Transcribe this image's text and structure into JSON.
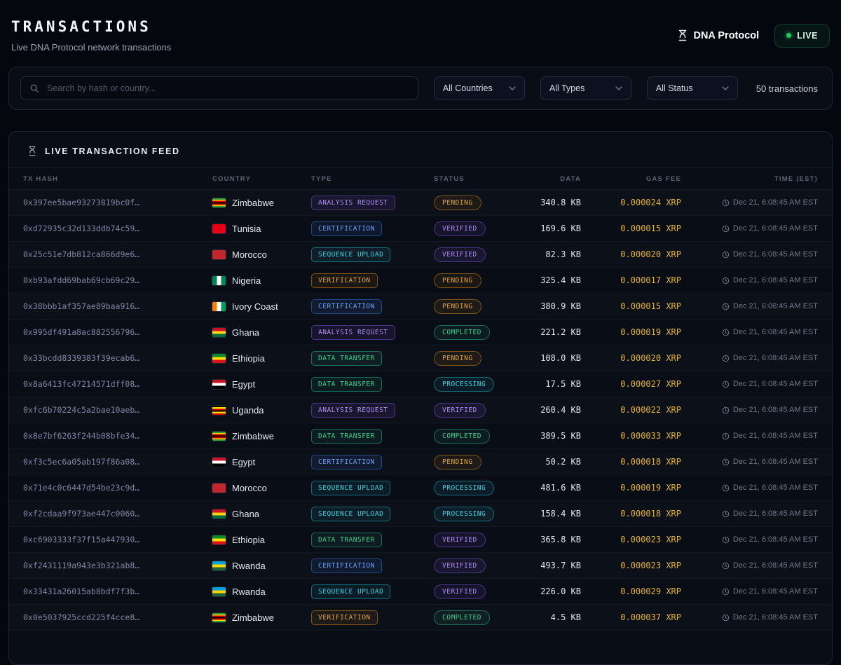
{
  "header": {
    "title": "TRANSACTIONS",
    "subtitle": "Live DNA Protocol network transactions",
    "brand": "DNA Protocol",
    "live_label": "LIVE"
  },
  "filters": {
    "search_placeholder": "Search by hash or country...",
    "country_filter": "All Countries",
    "type_filter": "All Types",
    "status_filter": "All Status",
    "count_label": "50 transactions"
  },
  "colors": {
    "background": "#05070e",
    "panel": "#090d16",
    "live_green": "#22c55e",
    "gas_gold": "#e4b23c",
    "purple": "#b18cf5",
    "blue": "#6ea2f8",
    "cyan": "#3fd2e2",
    "amber": "#dfa73b",
    "green": "#3ecf8e"
  },
  "flags": {
    "zimbabwe": {
      "dir": "h",
      "colors": [
        "#319e3f",
        "#ffd200",
        "#d40000",
        "#000000",
        "#d40000",
        "#ffd200",
        "#319e3f"
      ]
    },
    "tunisia": {
      "dir": "h",
      "colors": [
        "#e70013"
      ]
    },
    "morocco": {
      "dir": "h",
      "colors": [
        "#c1272d"
      ]
    },
    "nigeria": {
      "dir": "v",
      "colors": [
        "#008751",
        "#ffffff",
        "#008751"
      ]
    },
    "ivory-coast": {
      "dir": "v",
      "colors": [
        "#f77f00",
        "#ffffff",
        "#009e60"
      ]
    },
    "ghana": {
      "dir": "h",
      "colors": [
        "#ce1126",
        "#fcd116",
        "#006b3f"
      ]
    },
    "ethiopia": {
      "dir": "h",
      "colors": [
        "#078930",
        "#fcdd09",
        "#da121a"
      ]
    },
    "egypt": {
      "dir": "h",
      "colors": [
        "#ce1126",
        "#ffffff",
        "#000000"
      ]
    },
    "uganda": {
      "dir": "h",
      "colors": [
        "#000000",
        "#fcdc04",
        "#d90000",
        "#000000",
        "#fcdc04",
        "#d90000"
      ]
    },
    "rwanda": {
      "dir": "h",
      "colors": [
        "#00a1de",
        "#fad201",
        "#20603d"
      ]
    }
  },
  "feed": {
    "title": "LIVE TRANSACTION FEED",
    "columns": [
      "TX HASH",
      "COUNTRY",
      "TYPE",
      "STATUS",
      "DATA",
      "GAS FEE",
      "TIME (EST)"
    ],
    "rows": [
      {
        "hash": "0x397ee5bae93273819bc0f…",
        "country": "Zimbabwe",
        "flag": "zimbabwe",
        "type": "ANALYSIS REQUEST",
        "type_color": "purple",
        "status": "PENDING",
        "status_color": "amber",
        "data": "340.8 KB",
        "gas": "0.000024 XRP",
        "time": "Dec 21, 6:08:45 AM EST"
      },
      {
        "hash": "0xd72935c32d133ddb74c59…",
        "country": "Tunisia",
        "flag": "tunisia",
        "type": "CERTIFICATION",
        "type_color": "blue",
        "status": "VERIFIED",
        "status_color": "purple",
        "data": "169.6 KB",
        "gas": "0.000015 XRP",
        "time": "Dec 21, 6:08:45 AM EST"
      },
      {
        "hash": "0x25c51e7db812ca866d9e6…",
        "country": "Morocco",
        "flag": "morocco",
        "type": "SEQUENCE UPLOAD",
        "type_color": "cyan",
        "status": "VERIFIED",
        "status_color": "purple",
        "data": "82.3 KB",
        "gas": "0.000020 XRP",
        "time": "Dec 21, 6:08:45 AM EST"
      },
      {
        "hash": "0xb93afdd69bab69cb69c29…",
        "country": "Nigeria",
        "flag": "nigeria",
        "type": "VERIFICATION",
        "type_color": "amber",
        "status": "PENDING",
        "status_color": "amber",
        "data": "325.4 KB",
        "gas": "0.000017 XRP",
        "time": "Dec 21, 6:08:45 AM EST"
      },
      {
        "hash": "0x38bbb1af357ae89baa916…",
        "country": "Ivory Coast",
        "flag": "ivory-coast",
        "type": "CERTIFICATION",
        "type_color": "blue",
        "status": "PENDING",
        "status_color": "amber",
        "data": "380.9 KB",
        "gas": "0.000015 XRP",
        "time": "Dec 21, 6:08:45 AM EST"
      },
      {
        "hash": "0x995df491a8ac882556796…",
        "country": "Ghana",
        "flag": "ghana",
        "type": "ANALYSIS REQUEST",
        "type_color": "purple",
        "status": "COMPLETED",
        "status_color": "green",
        "data": "221.2 KB",
        "gas": "0.000019 XRP",
        "time": "Dec 21, 6:08:45 AM EST"
      },
      {
        "hash": "0x33bcdd8339383f39ecab6…",
        "country": "Ethiopia",
        "flag": "ethiopia",
        "type": "DATA TRANSFER",
        "type_color": "green",
        "status": "PENDING",
        "status_color": "amber",
        "data": "108.0 KB",
        "gas": "0.000020 XRP",
        "time": "Dec 21, 6:08:45 AM EST"
      },
      {
        "hash": "0x8a6413fc47214571dff08…",
        "country": "Egypt",
        "flag": "egypt",
        "type": "DATA TRANSFER",
        "type_color": "green",
        "status": "PROCESSING",
        "status_color": "cyan",
        "data": "17.5 KB",
        "gas": "0.000027 XRP",
        "time": "Dec 21, 6:08:45 AM EST"
      },
      {
        "hash": "0xfc6b70224c5a2bae10aeb…",
        "country": "Uganda",
        "flag": "uganda",
        "type": "ANALYSIS REQUEST",
        "type_color": "purple",
        "status": "VERIFIED",
        "status_color": "purple",
        "data": "260.4 KB",
        "gas": "0.000022 XRP",
        "time": "Dec 21, 6:08:45 AM EST"
      },
      {
        "hash": "0x8e7bf6263f244b08bfe34…",
        "country": "Zimbabwe",
        "flag": "zimbabwe",
        "type": "DATA TRANSFER",
        "type_color": "green",
        "status": "COMPLETED",
        "status_color": "green",
        "data": "389.5 KB",
        "gas": "0.000033 XRP",
        "time": "Dec 21, 6:08:45 AM EST"
      },
      {
        "hash": "0xf3c5ec6a05ab197f86a08…",
        "country": "Egypt",
        "flag": "egypt",
        "type": "CERTIFICATION",
        "type_color": "blue",
        "status": "PENDING",
        "status_color": "amber",
        "data": "50.2 KB",
        "gas": "0.000018 XRP",
        "time": "Dec 21, 6:08:45 AM EST"
      },
      {
        "hash": "0x71e4c0c6447d54be23c9d…",
        "country": "Morocco",
        "flag": "morocco",
        "type": "SEQUENCE UPLOAD",
        "type_color": "cyan",
        "status": "PROCESSING",
        "status_color": "cyan",
        "data": "481.6 KB",
        "gas": "0.000019 XRP",
        "time": "Dec 21, 6:08:45 AM EST"
      },
      {
        "hash": "0xf2cdaa9f973ae447c0060…",
        "country": "Ghana",
        "flag": "ghana",
        "type": "SEQUENCE UPLOAD",
        "type_color": "cyan",
        "status": "PROCESSING",
        "status_color": "cyan",
        "data": "158.4 KB",
        "gas": "0.000018 XRP",
        "time": "Dec 21, 6:08:45 AM EST"
      },
      {
        "hash": "0xc6903333f37f15a447930…",
        "country": "Ethiopia",
        "flag": "ethiopia",
        "type": "DATA TRANSFER",
        "type_color": "green",
        "status": "VERIFIED",
        "status_color": "purple",
        "data": "365.8 KB",
        "gas": "0.000023 XRP",
        "time": "Dec 21, 6:08:45 AM EST"
      },
      {
        "hash": "0xf2431119a943e3b321ab8…",
        "country": "Rwanda",
        "flag": "rwanda",
        "type": "CERTIFICATION",
        "type_color": "blue",
        "status": "VERIFIED",
        "status_color": "purple",
        "data": "493.7 KB",
        "gas": "0.000023 XRP",
        "time": "Dec 21, 6:08:45 AM EST"
      },
      {
        "hash": "0x33431a26015ab8bdf7f3b…",
        "country": "Rwanda",
        "flag": "rwanda",
        "type": "SEQUENCE UPLOAD",
        "type_color": "cyan",
        "status": "VERIFIED",
        "status_color": "purple",
        "data": "226.0 KB",
        "gas": "0.000029 XRP",
        "time": "Dec 21, 6:08:45 AM EST"
      },
      {
        "hash": "0x0e5037925ccd225f4cce8…",
        "country": "Zimbabwe",
        "flag": "zimbabwe",
        "type": "VERIFICATION",
        "type_color": "amber",
        "status": "COMPLETED",
        "status_color": "green",
        "data": "4.5 KB",
        "gas": "0.000037 XRP",
        "time": "Dec 21, 6:08:45 AM EST"
      }
    ]
  }
}
